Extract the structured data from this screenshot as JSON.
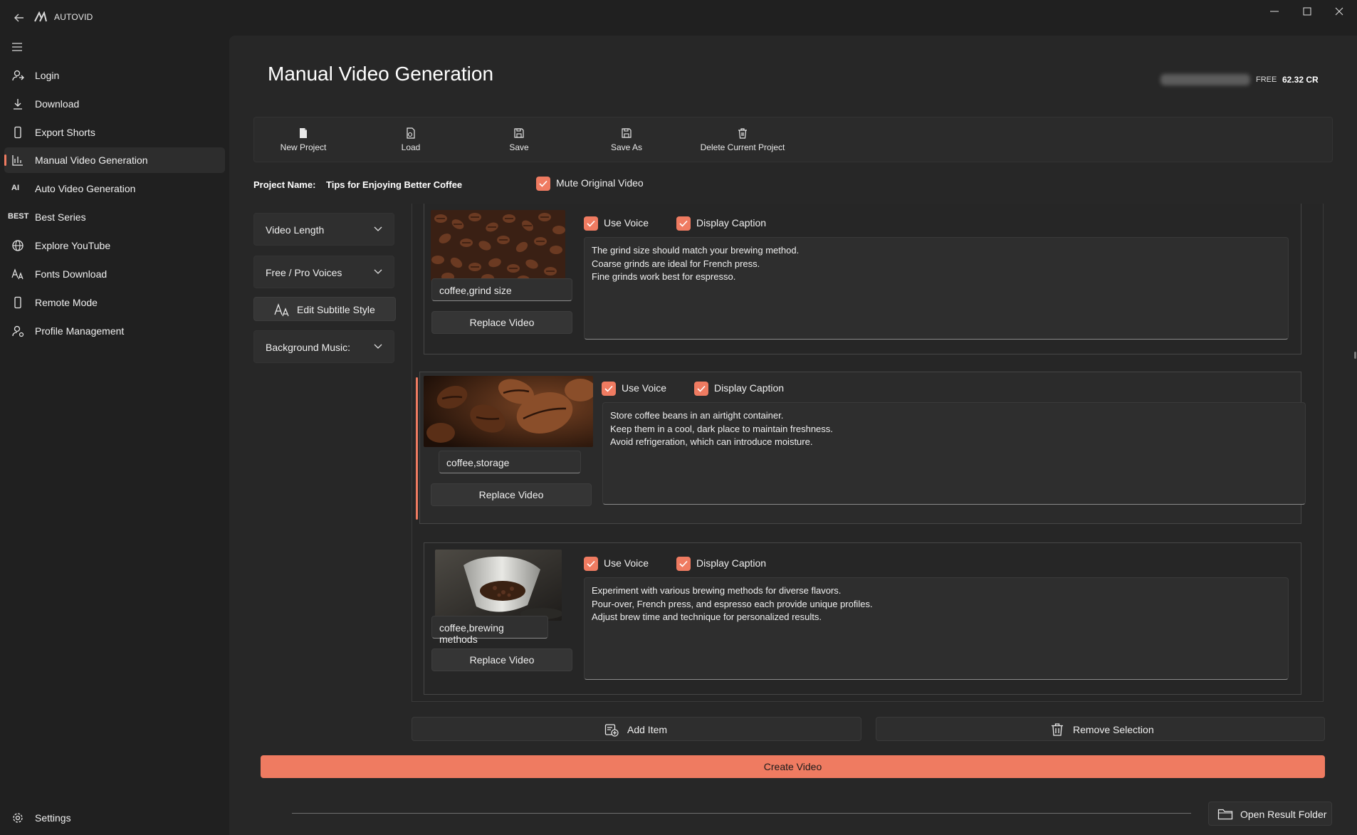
{
  "window": {
    "title": "AUTOVID",
    "accent_color": "#ef7b61"
  },
  "sidebar": {
    "items": [
      {
        "label": "Login",
        "icon": "login-icon"
      },
      {
        "label": "Download",
        "icon": "download-icon"
      },
      {
        "label": "Export Shorts",
        "icon": "phone-icon"
      },
      {
        "label": "Manual Video Generation",
        "icon": "chart-icon",
        "active": true
      },
      {
        "label": "Auto Video Generation",
        "icon": "ai-text-icon",
        "icon_text": "AI"
      },
      {
        "label": "Best Series",
        "icon": "best-text-icon",
        "icon_text": "BEST"
      },
      {
        "label": "Explore YouTube",
        "icon": "globe-icon"
      },
      {
        "label": "Fonts Download",
        "icon": "font-icon"
      },
      {
        "label": "Remote Mode",
        "icon": "phone-icon"
      },
      {
        "label": "Profile Management",
        "icon": "profile-icon"
      }
    ],
    "settings_label": "Settings"
  },
  "header": {
    "title": "Manual Video Generation",
    "plan": "FREE",
    "credits": "62.32 CR"
  },
  "toolbar": {
    "new_project": "New Project",
    "load": "Load",
    "save": "Save",
    "save_as": "Save As",
    "delete_project": "Delete Current Project"
  },
  "project": {
    "name_label": "Project Name:",
    "name_value": "Tips for Enjoying Better Coffee",
    "mute_label": "Mute Original Video",
    "mute_checked": true
  },
  "controls": {
    "video_length": "Video Length",
    "voices": "Free / Pro Voices",
    "subtitle_style": "Edit Subtitle Style",
    "background_music": "Background Music:"
  },
  "items": [
    {
      "use_voice": "Use Voice",
      "display_caption": "Display Caption",
      "keywords": "coffee,grind size",
      "replace_label": "Replace Video",
      "script": "The grind size should match your brewing method.\nCoarse grinds are ideal for French press.\nFine grinds work best for espresso.",
      "selected": false
    },
    {
      "use_voice": "Use Voice",
      "display_caption": "Display Caption",
      "keywords": "coffee,storage",
      "replace_label": "Replace Video",
      "script": "Store coffee beans in an airtight container.\nKeep them in a cool, dark place to maintain freshness.\nAvoid refrigeration, which can introduce moisture.",
      "selected": true
    },
    {
      "use_voice": "Use Voice",
      "display_caption": "Display Caption",
      "keywords": "coffee,brewing methods",
      "replace_label": "Replace Video",
      "script": "Experiment with various brewing methods for diverse flavors.\nPour-over, French press, and espresso each provide unique profiles.\nAdjust brew time and technique for personalized results.",
      "selected": false
    }
  ],
  "actions": {
    "add_item": "Add Item",
    "remove_selection": "Remove Selection",
    "create_video": "Create Video",
    "open_result_folder": "Open Result Folder"
  }
}
